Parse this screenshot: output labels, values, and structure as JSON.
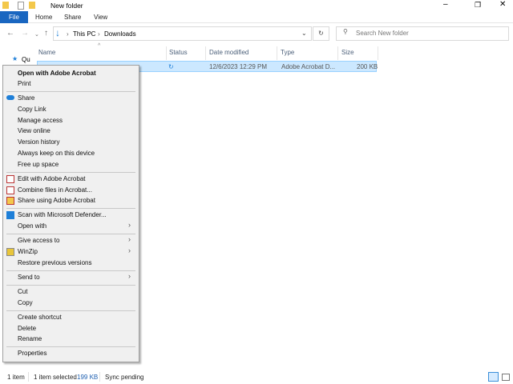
{
  "window": {
    "title": "New folder",
    "controls": [
      "minimize",
      "maximize",
      "close"
    ]
  },
  "ribbon": {
    "tabs": [
      "File",
      "Home",
      "Share",
      "View"
    ]
  },
  "address": {
    "crumbs": [
      "This PC",
      "Downloads"
    ],
    "search_placeholder": "Search New folder"
  },
  "nav_pane": {
    "quick_access_label": "Qu"
  },
  "columns": [
    "Name",
    "Status",
    "Date modified",
    "Type",
    "Size"
  ],
  "file": {
    "name": "",
    "status_icon": "sync-icon",
    "date": "12/6/2023 12:29 PM",
    "type": "Adobe Acrobat D...",
    "size": "200 KB"
  },
  "menu": {
    "items": [
      "Open with Adobe Acrobat",
      "Print",
      "Share",
      "Copy Link",
      "Manage access",
      "View online",
      "Version history",
      "Always keep on this device",
      "Free up space",
      "Edit with Adobe Acrobat",
      "Combine files in Acrobat...",
      "Share using Adobe Acrobat",
      "Scan with Microsoft Defender...",
      "Open with",
      "Give access to",
      "WinZip",
      "Restore previous versions",
      "Send to",
      "Cut",
      "Copy",
      "Create shortcut",
      "Delete",
      "Rename",
      "Properties"
    ]
  },
  "statusbar": {
    "count": "1 item",
    "selected": "1 item selected",
    "size": "199 KB",
    "sync": "Sync pending"
  },
  "colors": {
    "accent": "#1966c0",
    "selection": "#cce8ff"
  }
}
